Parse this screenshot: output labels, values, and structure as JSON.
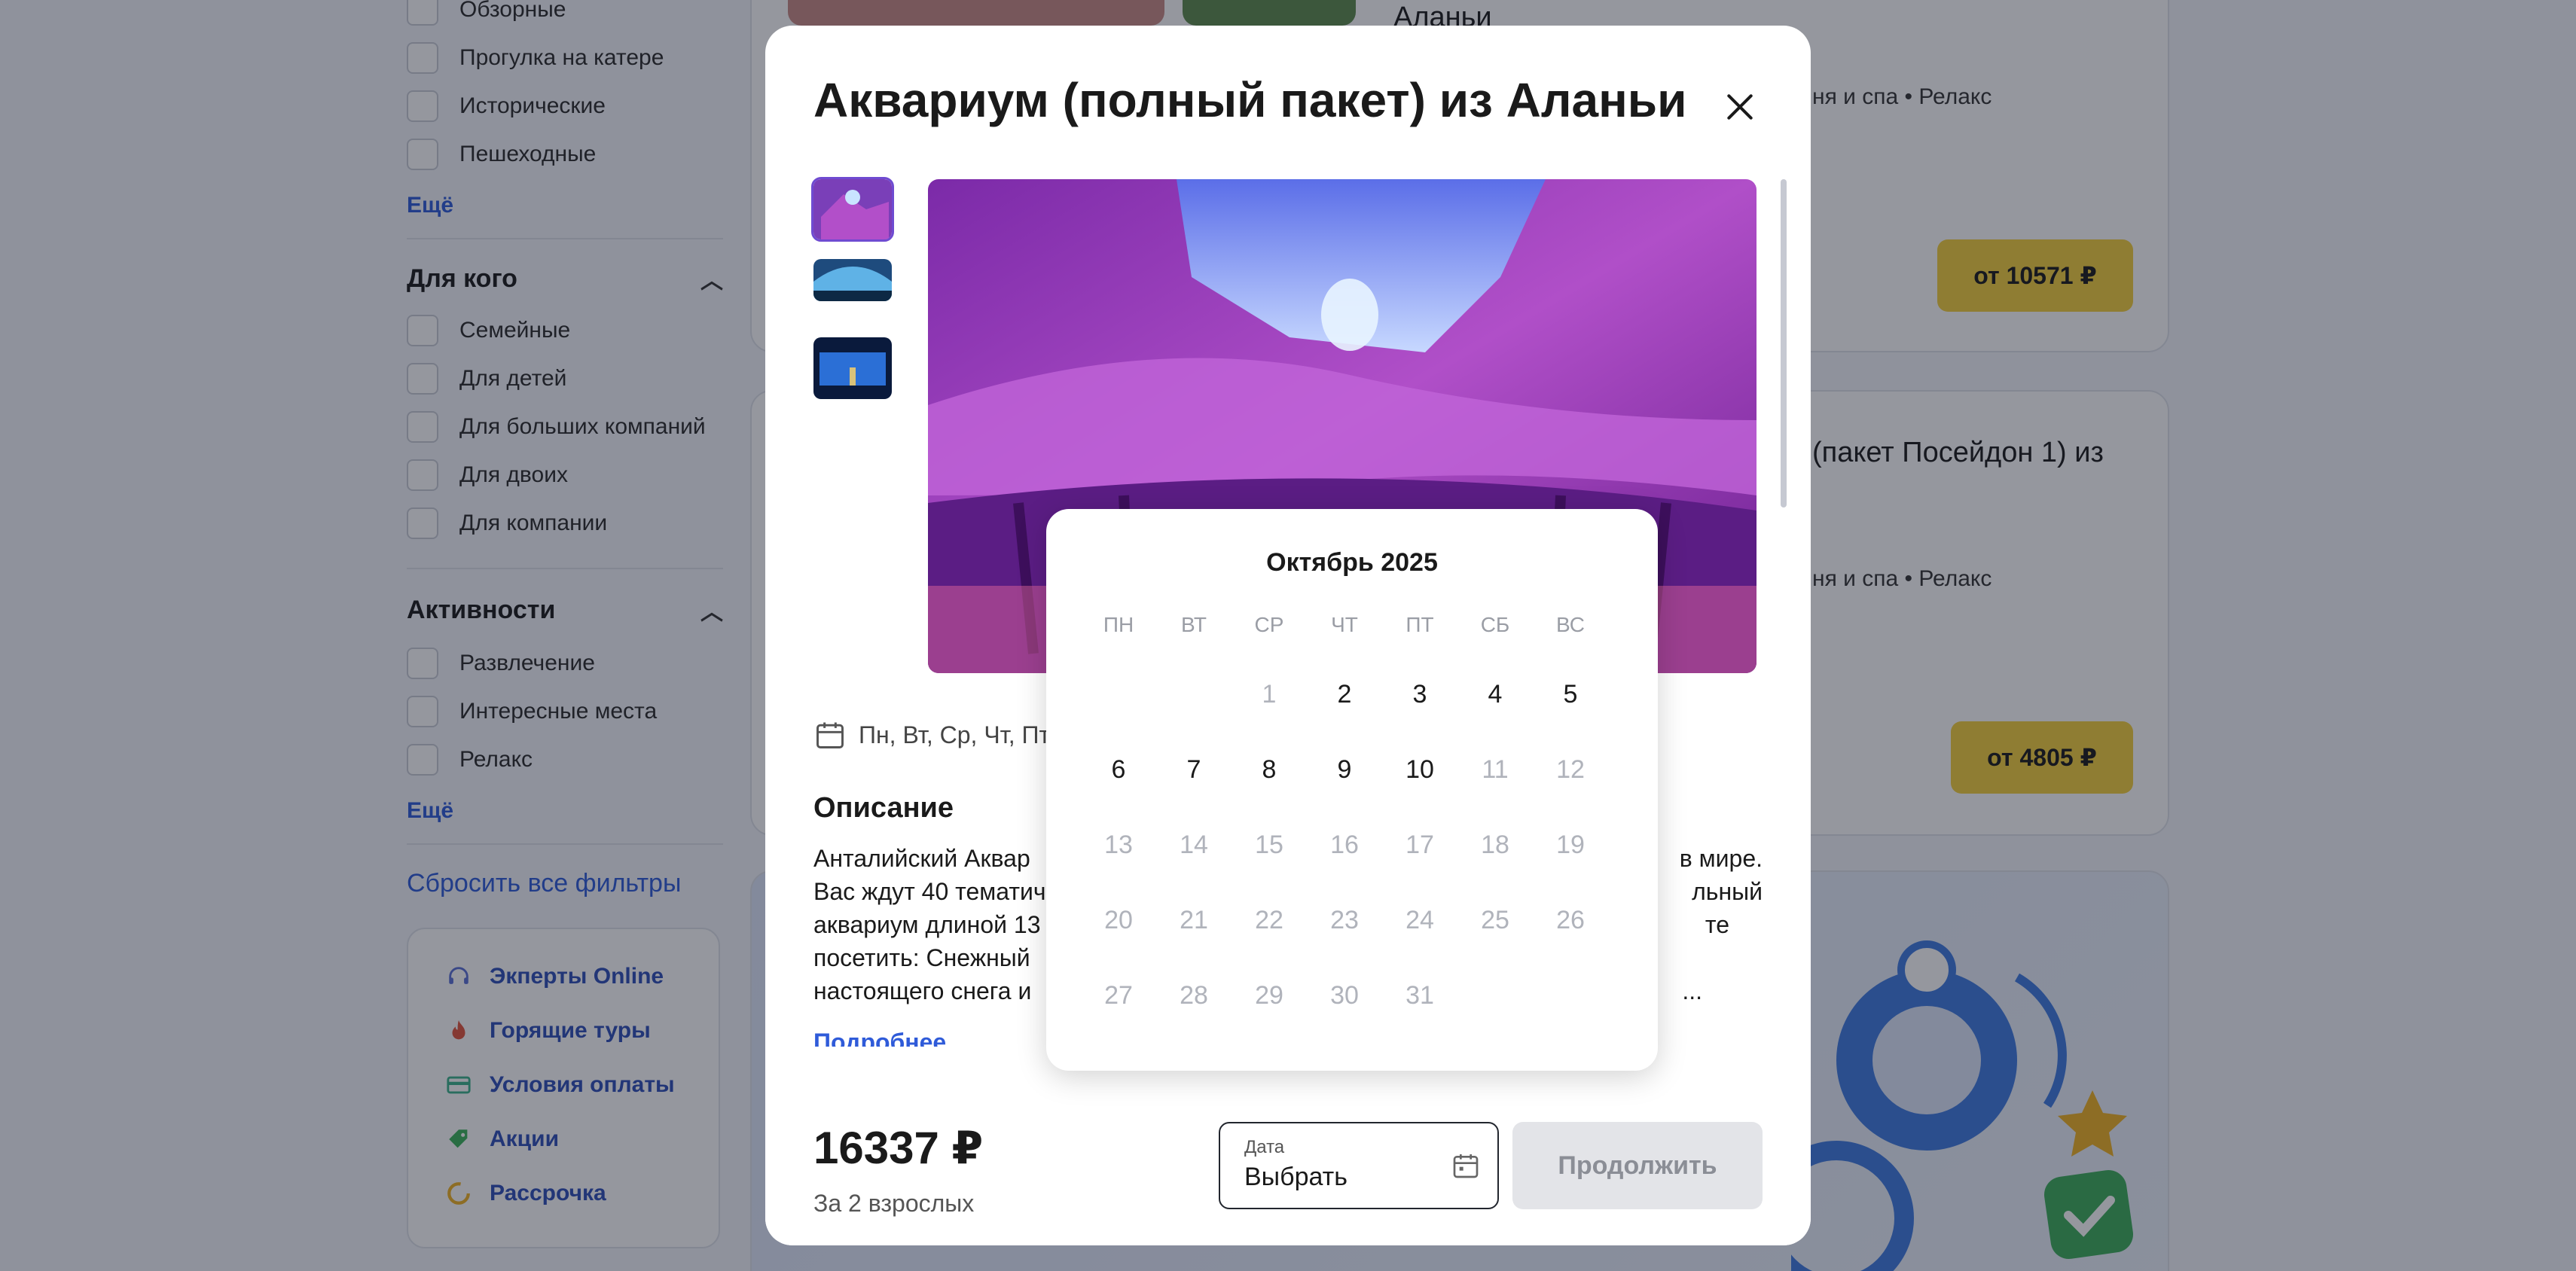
{
  "filters": {
    "group_top": {
      "items": [
        "Обзорные",
        "Прогулка на катере",
        "Исторические",
        "Пешеходные"
      ],
      "more": "Ещё"
    },
    "for_whom": {
      "title": "Для кого",
      "items": [
        "Семейные",
        "Для детей",
        "Для больших компаний",
        "Для двоих",
        "Для компании"
      ]
    },
    "activities": {
      "title": "Активности",
      "items": [
        "Развлечение",
        "Интересные места",
        "Релакс"
      ],
      "more": "Ещё"
    },
    "reset": "Сбросить все фильтры",
    "info_links": [
      {
        "label": "Экперты Online",
        "icon": "headset-icon"
      },
      {
        "label": "Горящие туры",
        "icon": "fire-icon"
      },
      {
        "label": "Условия оплаты",
        "icon": "card-icon"
      },
      {
        "label": "Акции",
        "icon": "tag-icon"
      },
      {
        "label": "Рассрочка",
        "icon": "installment-icon"
      }
    ]
  },
  "cards": [
    {
      "title_tail": "Аланьи",
      "tags_tail": "ня и спа • Релакс",
      "price": "от 10571 ₽"
    },
    {
      "title_tail": "(пакет Посейдон 1) из",
      "tags_tail": "ня и спа • Релакс",
      "price": "от 4805 ₽"
    }
  ],
  "modal": {
    "title": "Аквариум (полный пакет) из Аланьи",
    "days": "Пн, Вт, Ср, Чт, Пт",
    "description_title": "Описание",
    "description_lines": [
      "Анталийский Аквар",
      "Вас ждут 40 тематич",
      "аквариум длиной 13",
      "посетить: Снежный",
      "настоящего снега и"
    ],
    "description_lines_right": [
      "в мире.",
      "льный",
      "те",
      "",
      "..."
    ],
    "more": "Подробнее",
    "price": "16337 ₽",
    "price_sub": "За 2 взрослых",
    "date_label": "Дата",
    "date_value": "Выбрать",
    "continue": "Продолжить"
  },
  "calendar": {
    "title": "Октябрь 2025",
    "weekdays": [
      "ПН",
      "ВТ",
      "СР",
      "ЧТ",
      "ПТ",
      "СБ",
      "ВС"
    ],
    "weeks": [
      [
        null,
        null,
        {
          "d": "1",
          "on": false
        },
        {
          "d": "2",
          "on": true
        },
        {
          "d": "3",
          "on": true
        },
        {
          "d": "4",
          "on": true
        },
        {
          "d": "5",
          "on": true
        }
      ],
      [
        {
          "d": "6",
          "on": true
        },
        {
          "d": "7",
          "on": true
        },
        {
          "d": "8",
          "on": true
        },
        {
          "d": "9",
          "on": true
        },
        {
          "d": "10",
          "on": true
        },
        {
          "d": "11",
          "on": false
        },
        {
          "d": "12",
          "on": false
        }
      ],
      [
        {
          "d": "13",
          "on": false
        },
        {
          "d": "14",
          "on": false
        },
        {
          "d": "15",
          "on": false
        },
        {
          "d": "16",
          "on": false
        },
        {
          "d": "17",
          "on": false
        },
        {
          "d": "18",
          "on": false
        },
        {
          "d": "19",
          "on": false
        }
      ],
      [
        {
          "d": "20",
          "on": false
        },
        {
          "d": "21",
          "on": false
        },
        {
          "d": "22",
          "on": false
        },
        {
          "d": "23",
          "on": false
        },
        {
          "d": "24",
          "on": false
        },
        {
          "d": "25",
          "on": false
        },
        {
          "d": "26",
          "on": false
        }
      ],
      [
        {
          "d": "27",
          "on": false
        },
        {
          "d": "28",
          "on": false
        },
        {
          "d": "29",
          "on": false
        },
        {
          "d": "30",
          "on": false
        },
        {
          "d": "31",
          "on": false
        },
        null,
        null
      ]
    ]
  }
}
